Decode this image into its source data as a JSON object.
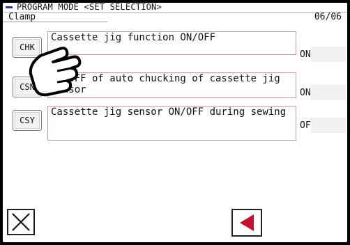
{
  "header": {
    "title": "PROGRAM MODE <SET SELECTION>"
  },
  "subbar": {
    "section": "Clamp",
    "page": "06/06"
  },
  "rows": [
    {
      "code": "CHK",
      "description": "Cassette jig function ON/OFF",
      "value": "ON"
    },
    {
      "code": "CSN",
      "description": "ON/OFF of auto chucking of cassette jig sensor",
      "value": "ON"
    },
    {
      "code": "CSY",
      "description": "Cassette jig sensor ON/OFF during sewing",
      "value": "OF"
    }
  ],
  "icons": {
    "close": "close-x-icon",
    "back": "left-arrow-icon",
    "pointer": "hand-pointer-icon"
  },
  "colors": {
    "accent": "#1f3bd6",
    "back_arrow": "#c8102e",
    "row_border": "#c79a9a"
  }
}
